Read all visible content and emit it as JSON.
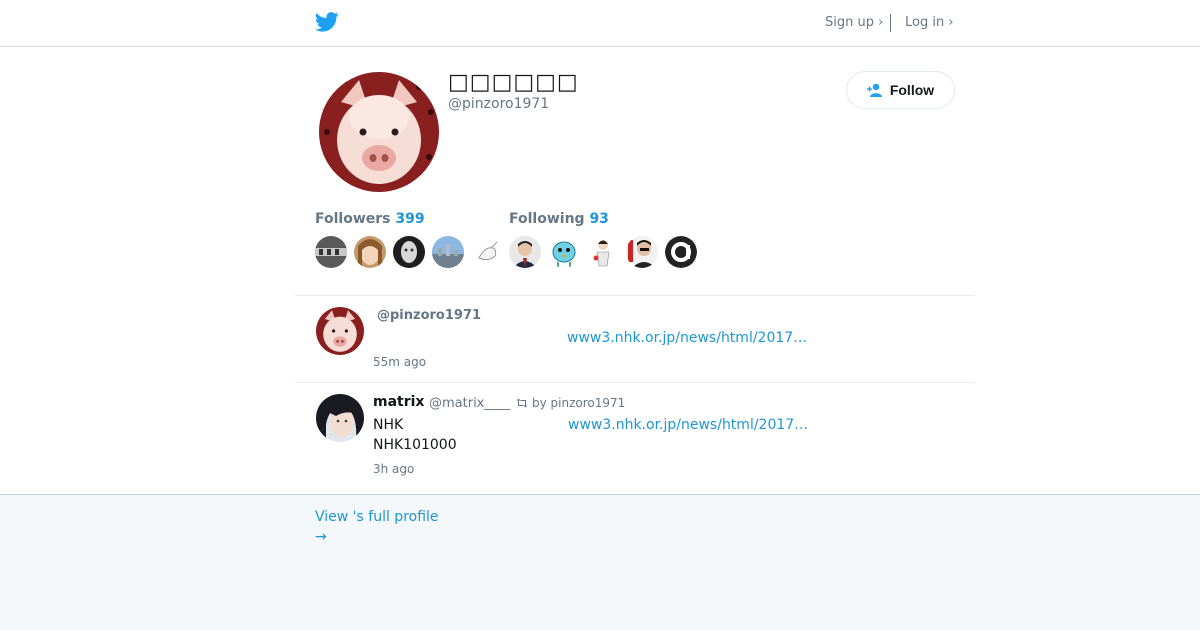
{
  "colors": {
    "brand": "#1da1f2",
    "link": "#1d96d6",
    "muted": "#657786",
    "text": "#14171a"
  },
  "header": {
    "logo_icon": "twitter-bird-icon",
    "signup_label": "Sign up ›",
    "login_label": "Log in ›"
  },
  "profile": {
    "display_name": "□□□□□□",
    "screen_name": "@pinzoro1971",
    "avatar_icon": "pig-avatar",
    "follow_label": "Follow"
  },
  "stats": {
    "followers_label": "Followers",
    "followers_count": "399",
    "following_label": "Following",
    "following_count": "93"
  },
  "tweets": [
    {
      "name": "",
      "handle": "@pinzoro1971",
      "retweet_by": "",
      "lines": [],
      "link": "www3.nhk.or.jp/news/html/2017…",
      "time": "55m ago"
    },
    {
      "name": "matrix",
      "handle": "@matrix____",
      "retweet_by": "by pinzoro1971",
      "lines": [
        "NHK",
        "NHK101000"
      ],
      "link": "www3.nhk.or.jp/news/html/2017…",
      "time": "3h ago"
    }
  ],
  "footer": {
    "full_profile_label": "View 's full profile",
    "arrow": "→"
  }
}
